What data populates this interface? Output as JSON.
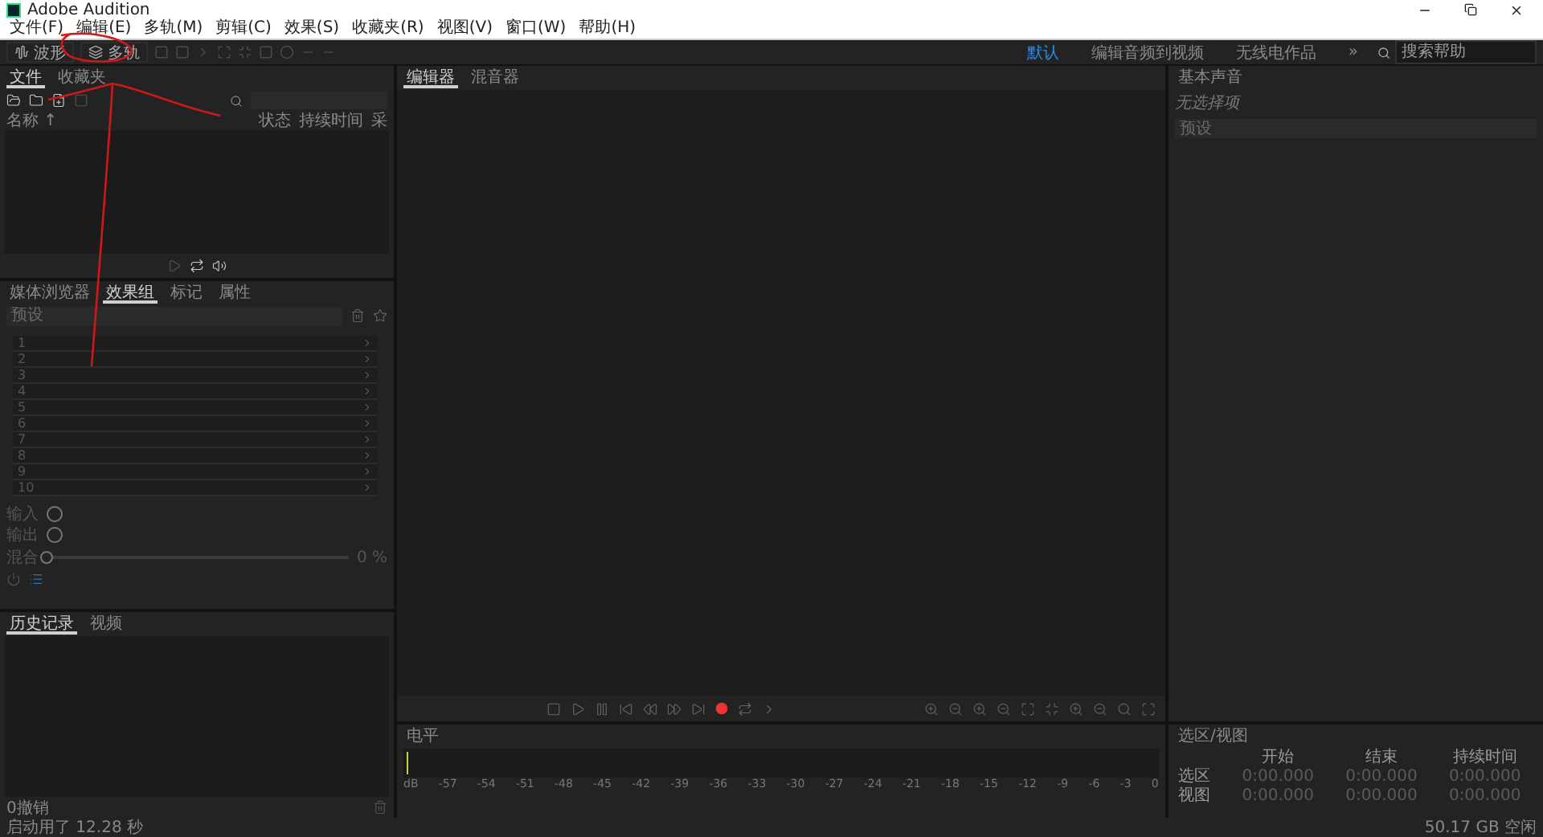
{
  "window": {
    "title": "Adobe Audition"
  },
  "menu": [
    "文件(F)",
    "编辑(E)",
    "多轨(M)",
    "剪辑(C)",
    "效果(S)",
    "收藏夹(R)",
    "视图(V)",
    "窗口(W)",
    "帮助(H)"
  ],
  "modes": [
    {
      "label": "波形",
      "selected": false
    },
    {
      "label": "多轨",
      "selected": false
    }
  ],
  "workspaces": [
    {
      "label": "默认",
      "selected": true
    },
    {
      "label": "编辑音频到视频",
      "selected": false
    },
    {
      "label": "无线电作品",
      "selected": false
    }
  ],
  "overflow": "»",
  "search": {
    "placeholder": "搜索帮助"
  },
  "files_panel": {
    "tabs": [
      {
        "label": "文件",
        "selected": true
      },
      {
        "label": "收藏夹",
        "selected": false
      }
    ],
    "columns": [
      "名称 ↑",
      "状态",
      "持续时间",
      "采"
    ]
  },
  "editor": {
    "tabs": [
      {
        "label": "编辑器",
        "selected": true
      },
      {
        "label": "混音器",
        "selected": false
      }
    ]
  },
  "essential_sound": {
    "title": "基本声音",
    "message": "无选择项",
    "preset": {
      "placeholder": "预设"
    }
  },
  "effects_panel": {
    "tabs": [
      {
        "label": "媒体浏览器",
        "selected": false
      },
      {
        "label": "效果组",
        "selected": true
      },
      {
        "label": "标记",
        "selected": false
      },
      {
        "label": "属性",
        "selected": false
      }
    ],
    "preset": {
      "placeholder": "预设"
    },
    "slots": [
      "1",
      "2",
      "3",
      "4",
      "5",
      "6",
      "7",
      "8",
      "9",
      "10"
    ],
    "input_label": "输入",
    "output_label": "输出",
    "mix": {
      "label": "混合",
      "level": 0,
      "reading": "0 %"
    }
  },
  "history_panel": {
    "tabs": [
      {
        "label": "历史记录",
        "selected": true
      },
      {
        "label": "视频",
        "selected": false
      }
    ],
    "undo_count": "0撤销"
  },
  "levels": {
    "title": "电平",
    "scale": [
      "dB",
      "-57",
      "-54",
      "-51",
      "-48",
      "-45",
      "-42",
      "-39",
      "-36",
      "-33",
      "-30",
      "-27",
      "-24",
      "-21",
      "-18",
      "-15",
      "-12",
      "-9",
      "-6",
      "-3",
      "0"
    ]
  },
  "selection_view": {
    "title": "选区/视图",
    "columns": [
      "开始",
      "结束",
      "持续时间"
    ],
    "rows": [
      {
        "label": "选区",
        "values": [
          "0:00.000",
          "0:00.000",
          "0:00.000"
        ]
      },
      {
        "label": "视图",
        "values": [
          "0:00.000",
          "0:00.000",
          "0:00.000"
        ]
      }
    ]
  },
  "status_bar": {
    "message": "启动用了 12.28 秒",
    "disk": "50.17 GB 空闲"
  }
}
